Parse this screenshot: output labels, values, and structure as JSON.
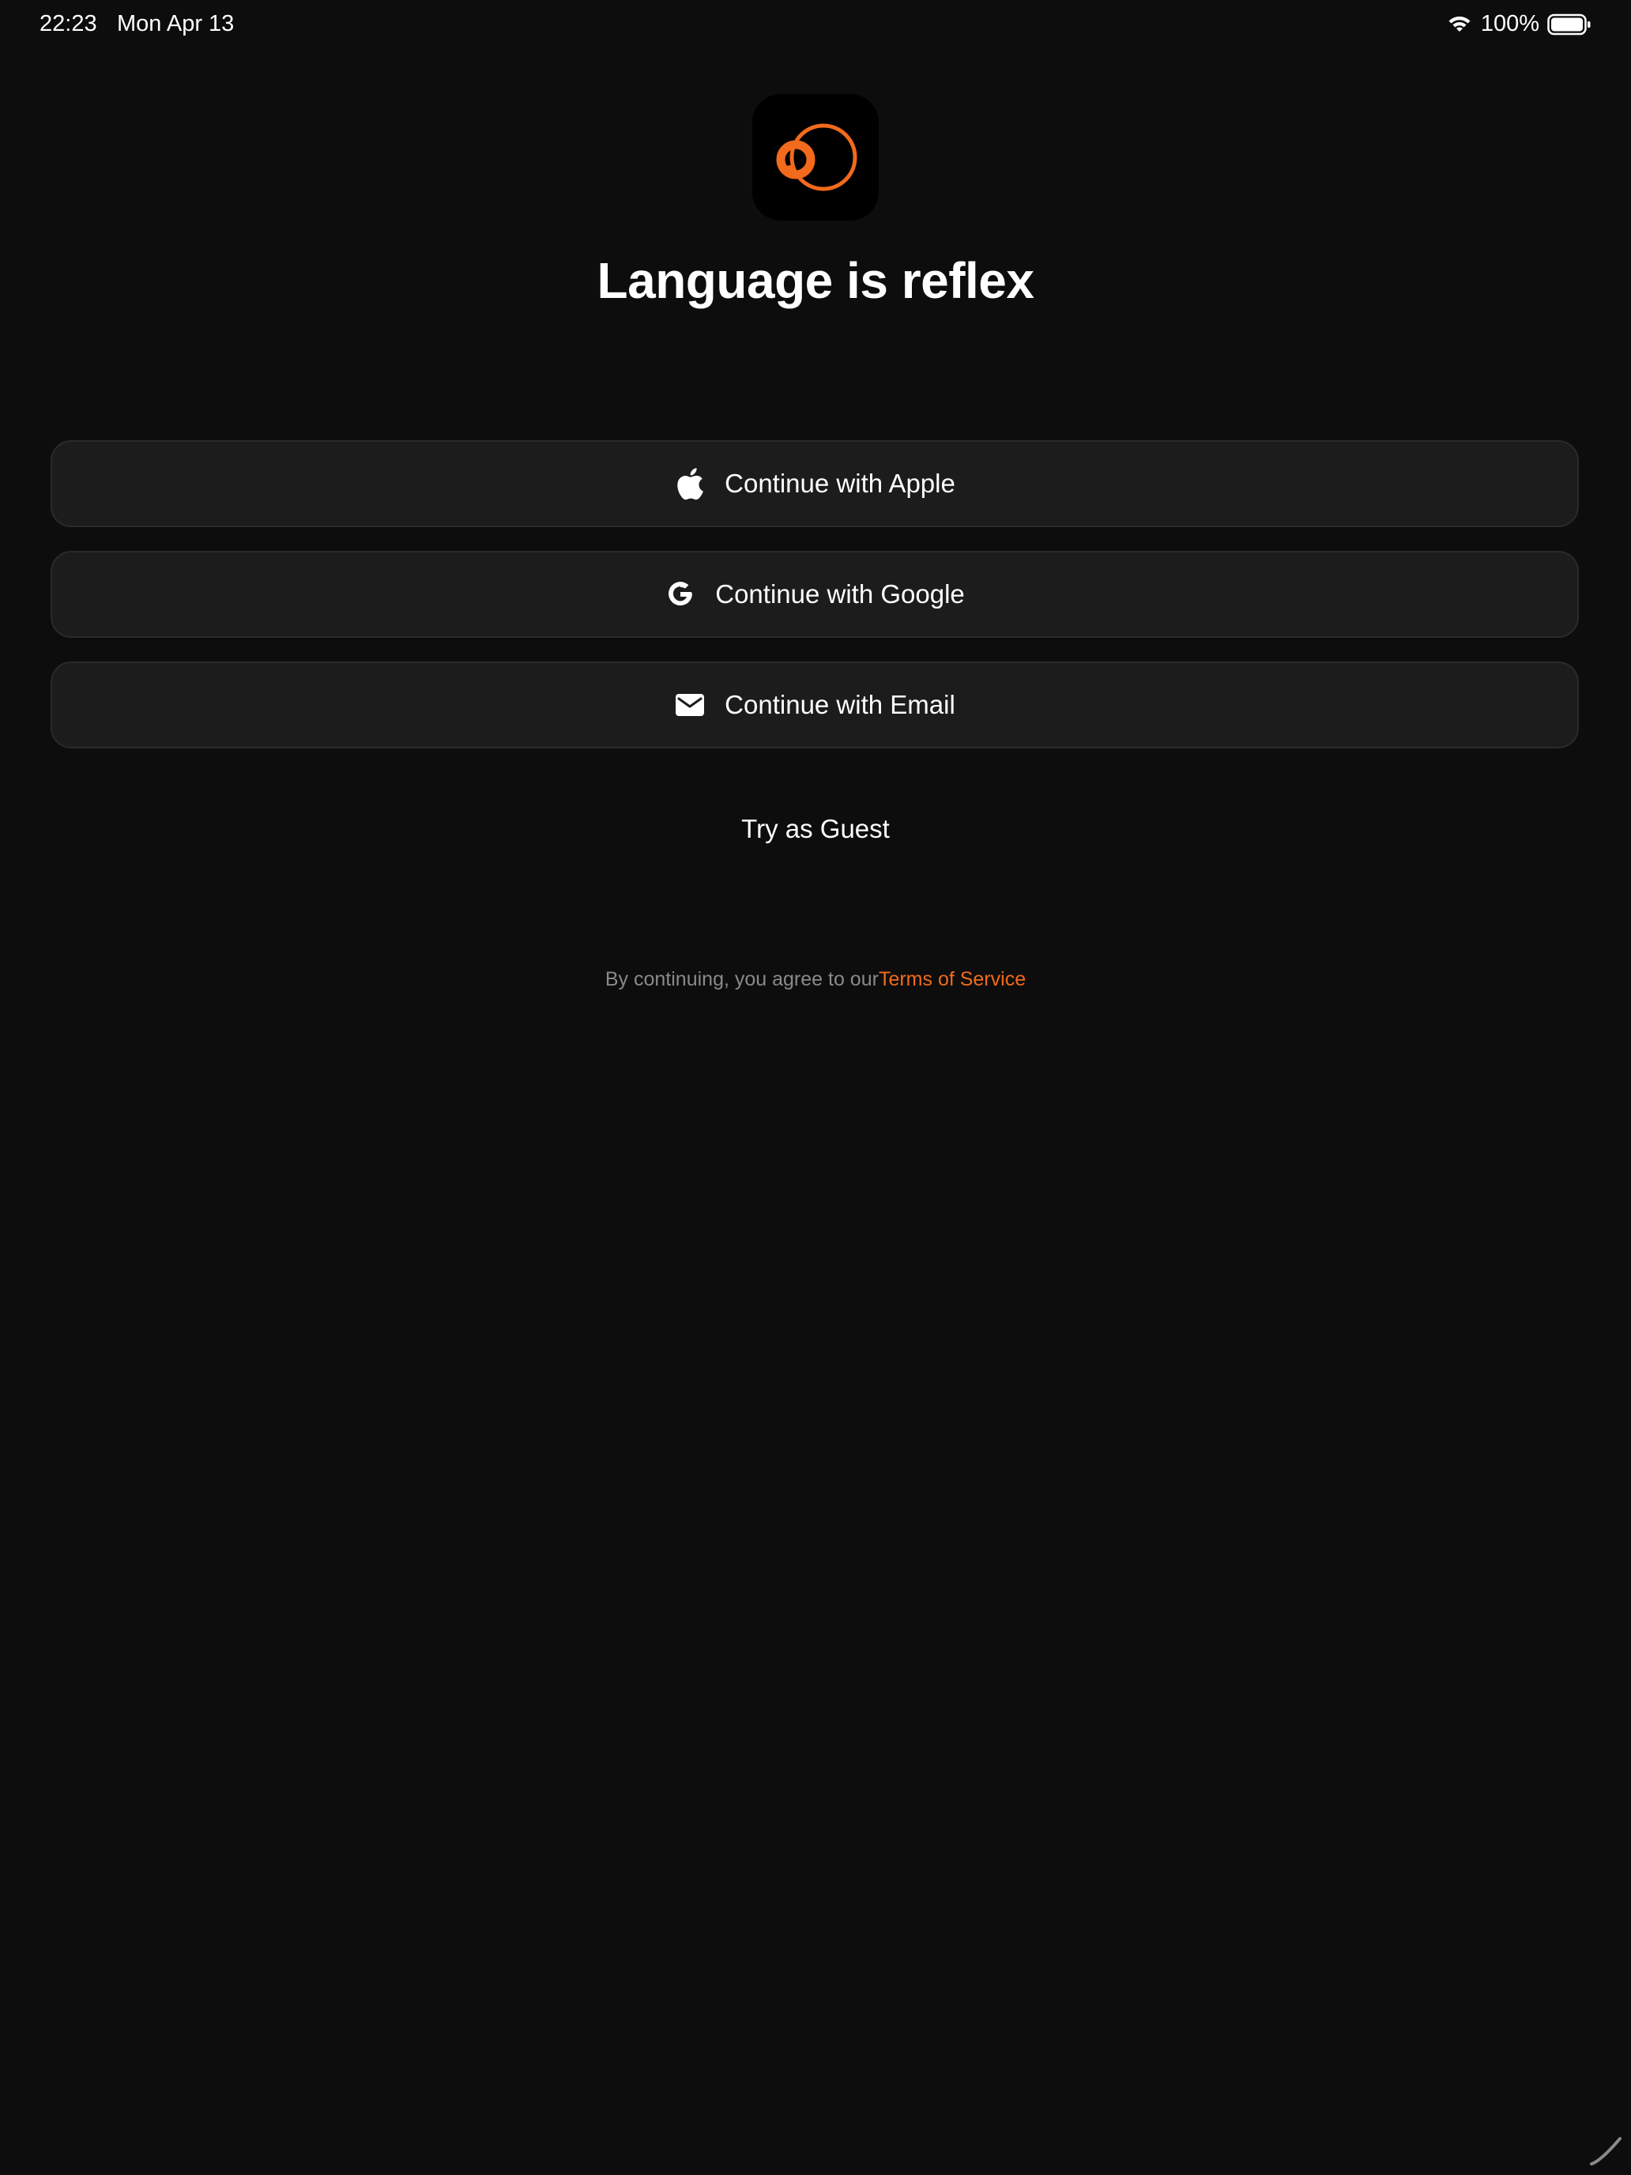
{
  "status_bar": {
    "time": "22:23",
    "date": "Mon Apr 13",
    "battery_percent": "100%",
    "wifi_icon": "wifi-icon",
    "battery_icon": "battery-icon"
  },
  "app": {
    "logo_icon": "app-logo-icon",
    "headline": "Language is reflex"
  },
  "auth": {
    "apple": {
      "label": "Continue with Apple",
      "icon": "apple-icon"
    },
    "google": {
      "label": "Continue with Google",
      "icon": "google-icon"
    },
    "email": {
      "label": "Continue with Email",
      "icon": "envelope-icon"
    },
    "guest": "Try as Guest"
  },
  "terms": {
    "prefix": "By continuing, you agree to our",
    "link": "Terms of Service"
  },
  "colors": {
    "background": "#0d0d0d",
    "button_bg": "#1c1c1c",
    "accent": "#f26a1b",
    "muted_text": "#8a8a8a"
  }
}
